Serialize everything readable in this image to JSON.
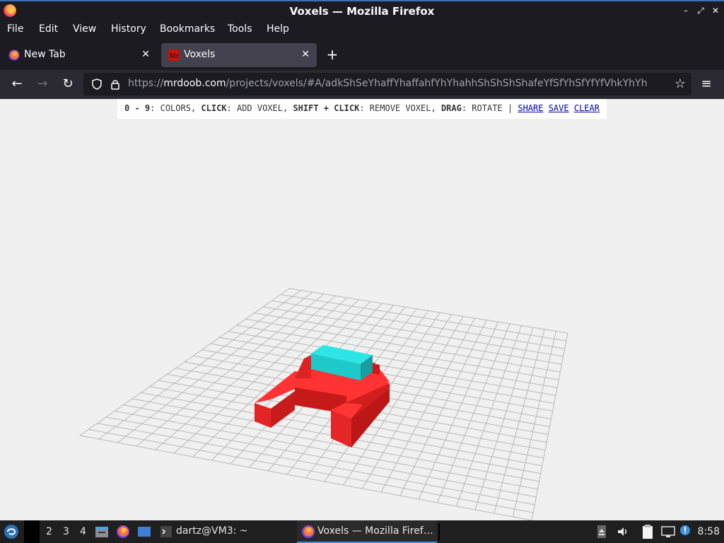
{
  "window": {
    "title": "Voxels — Mozilla Firefox"
  },
  "menu": [
    "File",
    "Edit",
    "View",
    "History",
    "Bookmarks",
    "Tools",
    "Help"
  ],
  "tabs": [
    {
      "label": "New Tab",
      "active": false
    },
    {
      "label": "Voxels",
      "active": true
    }
  ],
  "address": {
    "scheme": "https://",
    "host": "mrdoob.com",
    "path": "/projects/voxels/#A/adkShSeYhaffYhaffahfYhYhahhShShShShafeYfSfYhSfYfYfVhkYhYh"
  },
  "instructions": {
    "k1": "0 - 9",
    "t1": ": COLORS, ",
    "k2": "CLICK",
    "t2": ": ADD VOXEL, ",
    "k3": "SHIFT + CLICK",
    "t3": ": REMOVE VOXEL, ",
    "k4": "DRAG",
    "t4": ": ROTATE | ",
    "share": "SHARE",
    "save": "SAVE",
    "clear": "CLEAR"
  },
  "taskbar": {
    "workspaces": [
      "2",
      "3",
      "4"
    ],
    "terminal_label": "dartz@VM3: ~",
    "firefox_label": "Voxels — Mozilla Firef…",
    "clock": "8:58"
  },
  "colors": {
    "chrome_dark": "#1c1b22",
    "toolbar": "#2b2a33",
    "voxel_red": "#ee2222",
    "voxel_cyan": "#22dddd",
    "grid": "#b8b8b8"
  }
}
